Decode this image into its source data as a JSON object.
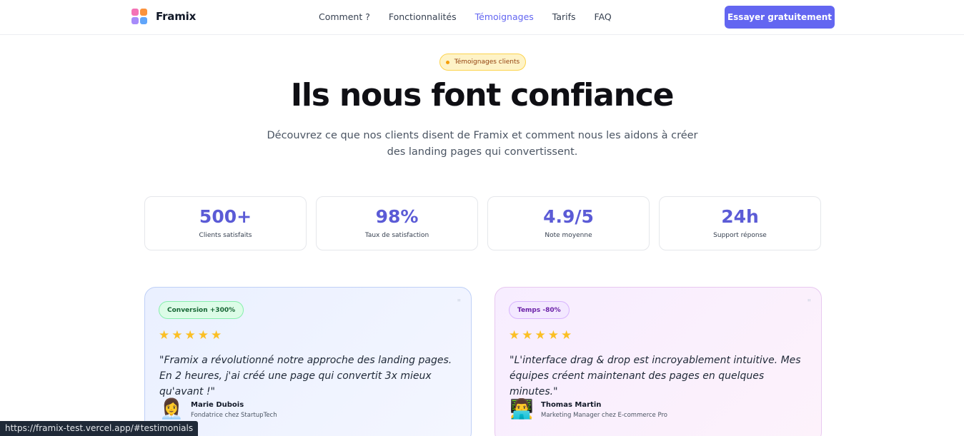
{
  "header": {
    "logo_text": "Framix",
    "nav": [
      {
        "label": "Comment ?"
      },
      {
        "label": "Fonctionnalités"
      },
      {
        "label": "Témoignages",
        "active": true
      },
      {
        "label": "Tarifs"
      },
      {
        "label": "FAQ"
      }
    ],
    "cta_label": "Essayer gratuitement"
  },
  "hero": {
    "badge": "Témoignages clients",
    "title": "Ils nous font confiance",
    "subtitle": "Découvrez ce que nos clients disent de Framix et comment nous les aidons à créer des landing pages qui convertissent."
  },
  "stats": [
    {
      "value": "500+",
      "label": "Clients satisfaits"
    },
    {
      "value": "98%",
      "label": "Taux de satisfaction"
    },
    {
      "value": "4.9/5",
      "label": "Note moyenne"
    },
    {
      "value": "24h",
      "label": "Support réponse"
    }
  ],
  "testimonials": [
    {
      "tag": "Conversion +300%",
      "stars": "★★★★★",
      "rating": 5,
      "quote": "\"Framix a révolutionné notre approche des landing pages. En 2 heures, j'ai créé une page qui convertit 3x mieux qu'avant !\"",
      "avatar": "👩‍💼",
      "name": "Marie Dubois",
      "role": "Fondatrice chez StartupTech"
    },
    {
      "tag": "Temps -80%",
      "stars": "★★★★★",
      "rating": 5,
      "quote": "\"L'interface drag & drop est incroyablement intuitive. Mes équipes créent maintenant des pages en quelques minutes.\"",
      "avatar": "👨‍💻",
      "name": "Thomas Martin",
      "role": "Marketing Manager chez E-commerce Pro"
    }
  ],
  "status_bar": {
    "url": "https://framix-test.vercel.app/#testimonials"
  },
  "colors": {
    "accent": "#6366f1",
    "stat_value": "#5b5bd6",
    "star": "#fbbf24"
  },
  "icons": {
    "logo": "four-squares-logo-icon",
    "quote": "quote-icon",
    "star": "star-icon"
  }
}
